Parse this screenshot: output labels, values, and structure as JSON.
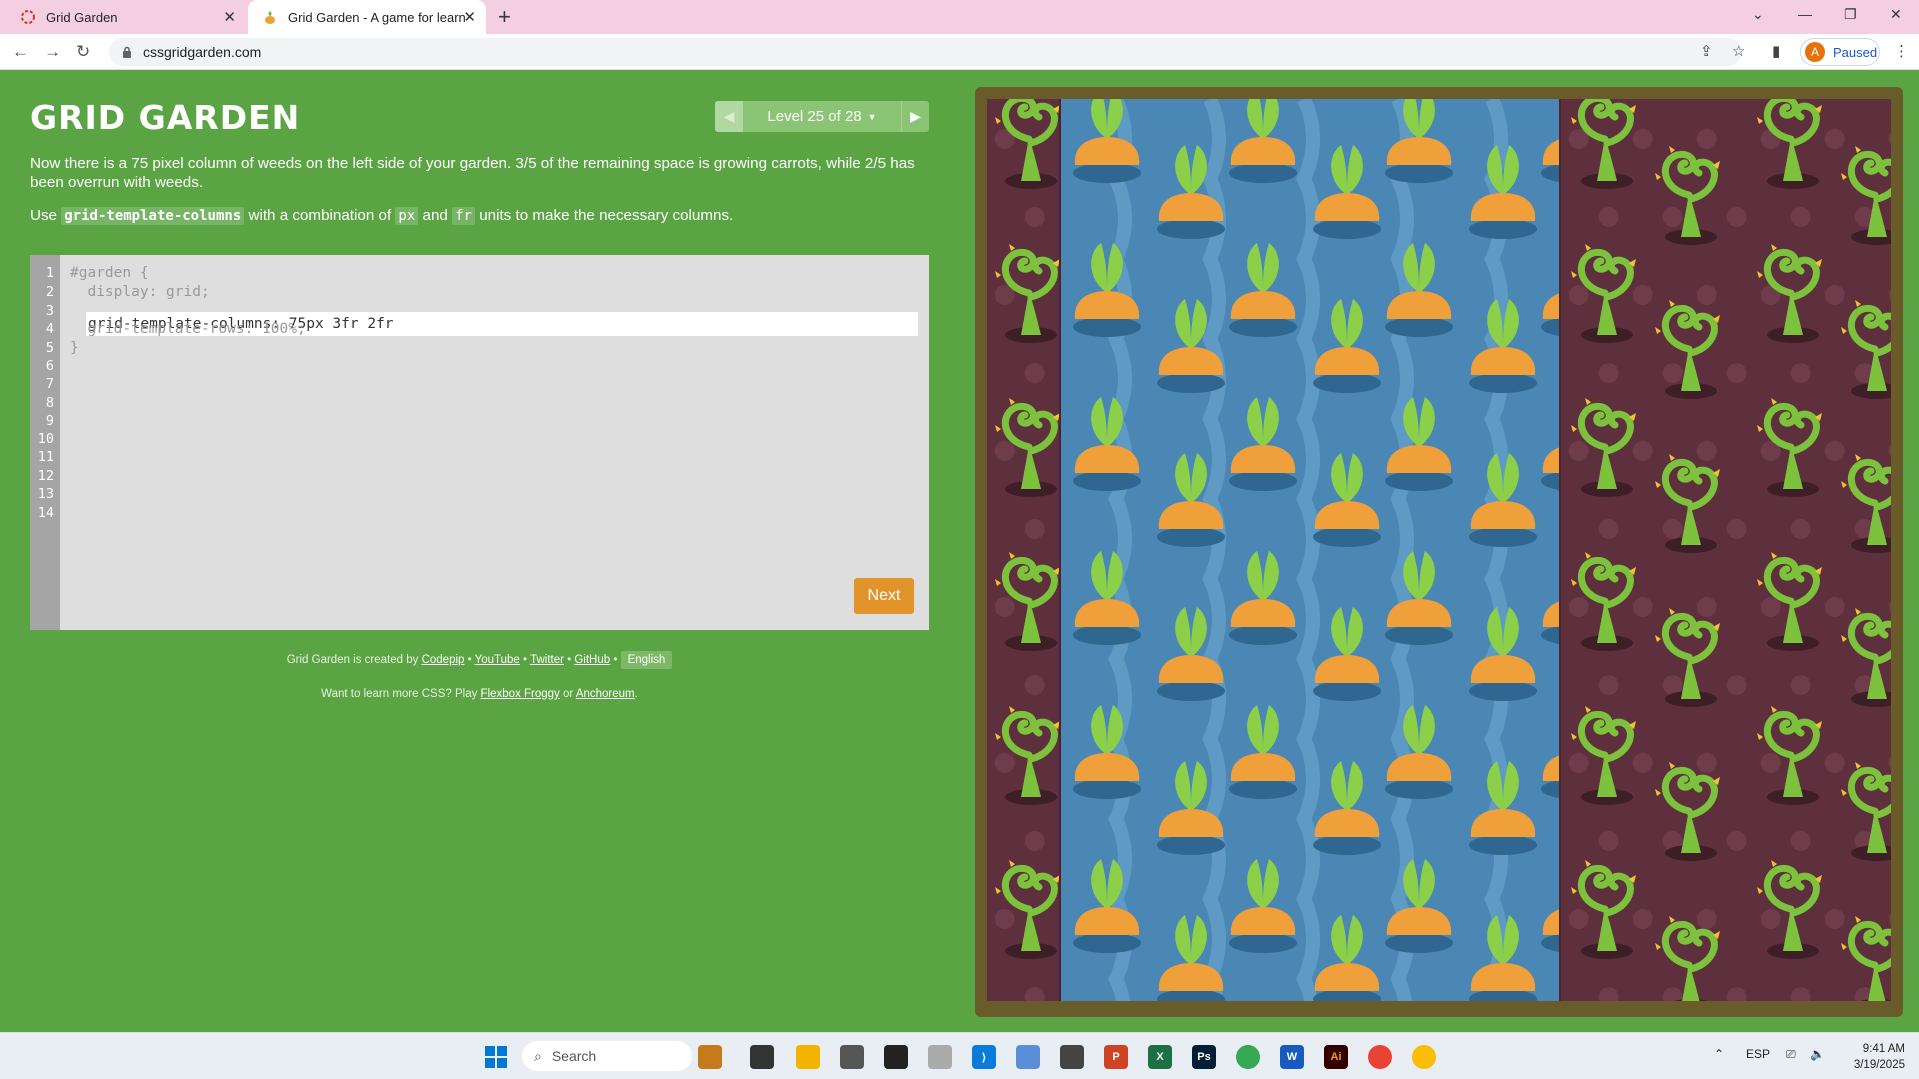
{
  "browser": {
    "tabs": [
      {
        "title": "Grid Garden",
        "active": false
      },
      {
        "title": "Grid Garden - A game for learning CSS grid",
        "active": true
      }
    ],
    "url": "cssgridgarden.com",
    "profile": {
      "initial": "A",
      "status": "Paused"
    }
  },
  "page": {
    "logo": "GRID GARDEN",
    "level_label": "Level 25 of 28",
    "instructions": {
      "p1": "Now there is a 75 pixel column of weeds on the left side of your garden. 3/5 of the remaining space is growing carrots, while 2/5 has been overrun with weeds.",
      "p2_prefix": "Use",
      "p2_code1": "grid-template-columns",
      "p2_mid1": "with a combination of",
      "p2_code2": "px",
      "p2_mid2": "and",
      "p2_code3": "fr",
      "p2_suffix": "units to make the necessary columns."
    },
    "editor": {
      "line_numbers": [
        "1",
        "2",
        "3",
        "4",
        "5",
        "6",
        "7",
        "8",
        "9",
        "10",
        "11",
        "12",
        "13",
        "14"
      ],
      "line1": "#garden {",
      "line2": "  display: grid;",
      "input_value": "grid-template-columns: 75px 3fr 2fr",
      "line4": "  grid-template-rows: 100%;",
      "line5": "}",
      "next_label": "Next"
    },
    "credits": {
      "prefix": "Grid Garden is created by",
      "codepip": "Codepip",
      "youtube": "YouTube",
      "twitter": "Twitter",
      "github": "GitHub",
      "language": "English",
      "line2_prefix": "Want to learn more CSS? Play",
      "flexbox": "Flexbox Froggy",
      "or": "or",
      "anchoreum": "Anchoreum"
    },
    "garden": {
      "columns": [
        "weeds",
        "carrots",
        "weeds"
      ],
      "colors": {
        "soil": "#5e2f3c",
        "water": "#4a87b4",
        "weed": "#7cc23c",
        "carrot": "#f0a03a",
        "leaf": "#8cd04a"
      }
    }
  },
  "taskbar": {
    "search_placeholder": "Search",
    "language": "ESP",
    "time": "9:41 AM",
    "date": "3/19/2025",
    "apps": [
      "windows-start",
      "search",
      "work-app",
      "terminal",
      "file-explorer",
      "game-app",
      "inkscape",
      "app-cube",
      "vscode",
      "app-paint",
      "app-pen",
      "powerpoint",
      "excel",
      "photoshop",
      "chrome",
      "word",
      "illustrator",
      "chrome-profile",
      "chrome-active"
    ]
  }
}
